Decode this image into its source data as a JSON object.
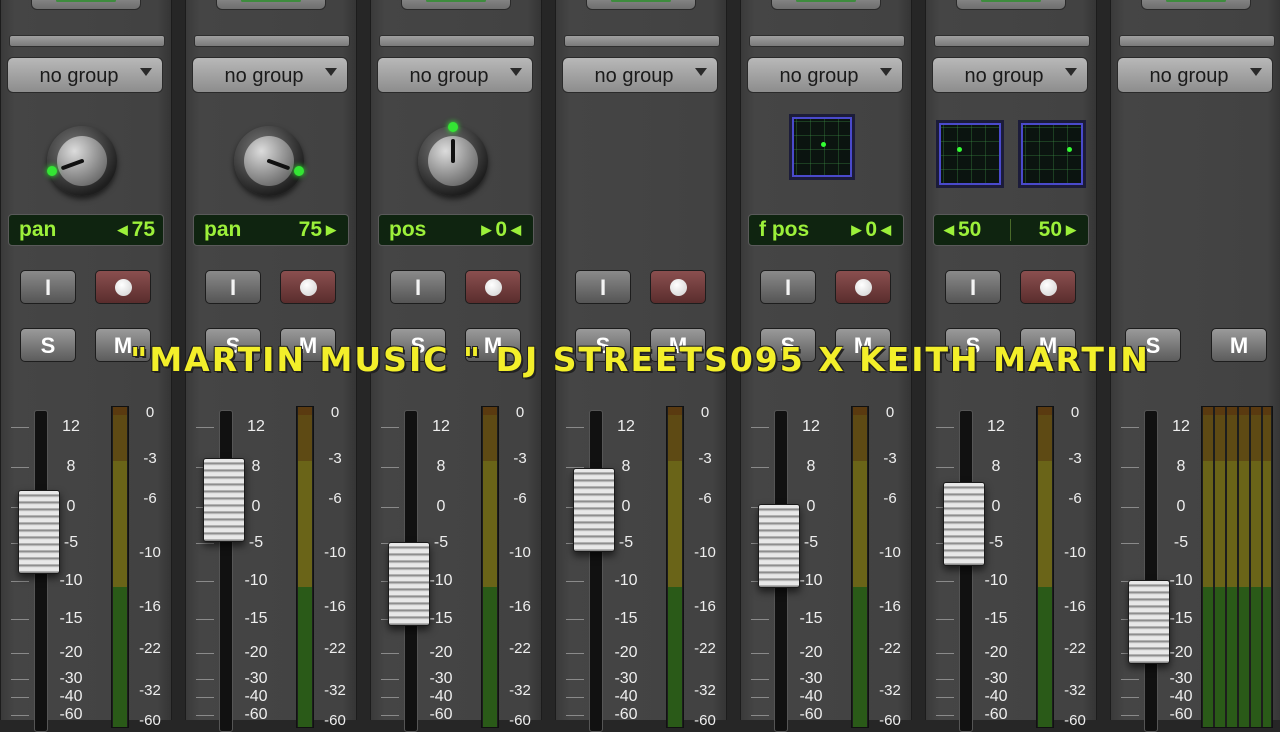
{
  "caption": "\"MARTIN MUSIC \" DJ STREETS095 X KEITH MARTIN",
  "accent_colors": {
    "lcd_text": "#9cf03a",
    "led_green": "#34e534",
    "caption_yellow": "#f3ef2a",
    "record_red": "#8a4f4f"
  },
  "group_label": "no group",
  "scale_labels": [
    "12",
    "8",
    "0",
    "-5",
    "-10",
    "-15",
    "-20",
    "-30",
    "-40",
    "-60"
  ],
  "meter_labels": [
    "0",
    "-3",
    "-6",
    "-10",
    "-16",
    "-22",
    "-32",
    "-60"
  ],
  "channels": [
    {
      "group": "no group",
      "control": "knob",
      "display_label": "pan",
      "display_value": "75",
      "input_label": "I",
      "solo_label": "S",
      "mute_label": "M",
      "fader_db": -3
    },
    {
      "group": "no group",
      "control": "knob",
      "display_label": "pan",
      "display_value": "75",
      "input_label": "I",
      "solo_label": "S",
      "mute_label": "M",
      "fader_db": 2
    },
    {
      "group": "no group",
      "control": "knob",
      "display_label": "pos",
      "display_value": "0",
      "input_label": "I",
      "solo_label": "S",
      "mute_label": "M",
      "fader_db": -10
    },
    {
      "group": "no group",
      "control": "none",
      "display_label": "",
      "display_value": "",
      "input_label": "I",
      "solo_label": "S",
      "mute_label": "M",
      "fader_db": 0
    },
    {
      "group": "no group",
      "control": "xy",
      "display_label": "f pos",
      "display_value": "0",
      "input_label": "I",
      "solo_label": "S",
      "mute_label": "M",
      "fader_db": -5
    },
    {
      "group": "no group",
      "control": "xy2",
      "display_label": "50",
      "display_value": "50",
      "input_label": "I",
      "solo_label": "S",
      "mute_label": "M",
      "fader_db": -2
    },
    {
      "group": "no group",
      "control": "none",
      "display_label": "",
      "display_value": "",
      "input_label": "",
      "solo_label": "S",
      "mute_label": "M",
      "fader_db": -15
    }
  ]
}
